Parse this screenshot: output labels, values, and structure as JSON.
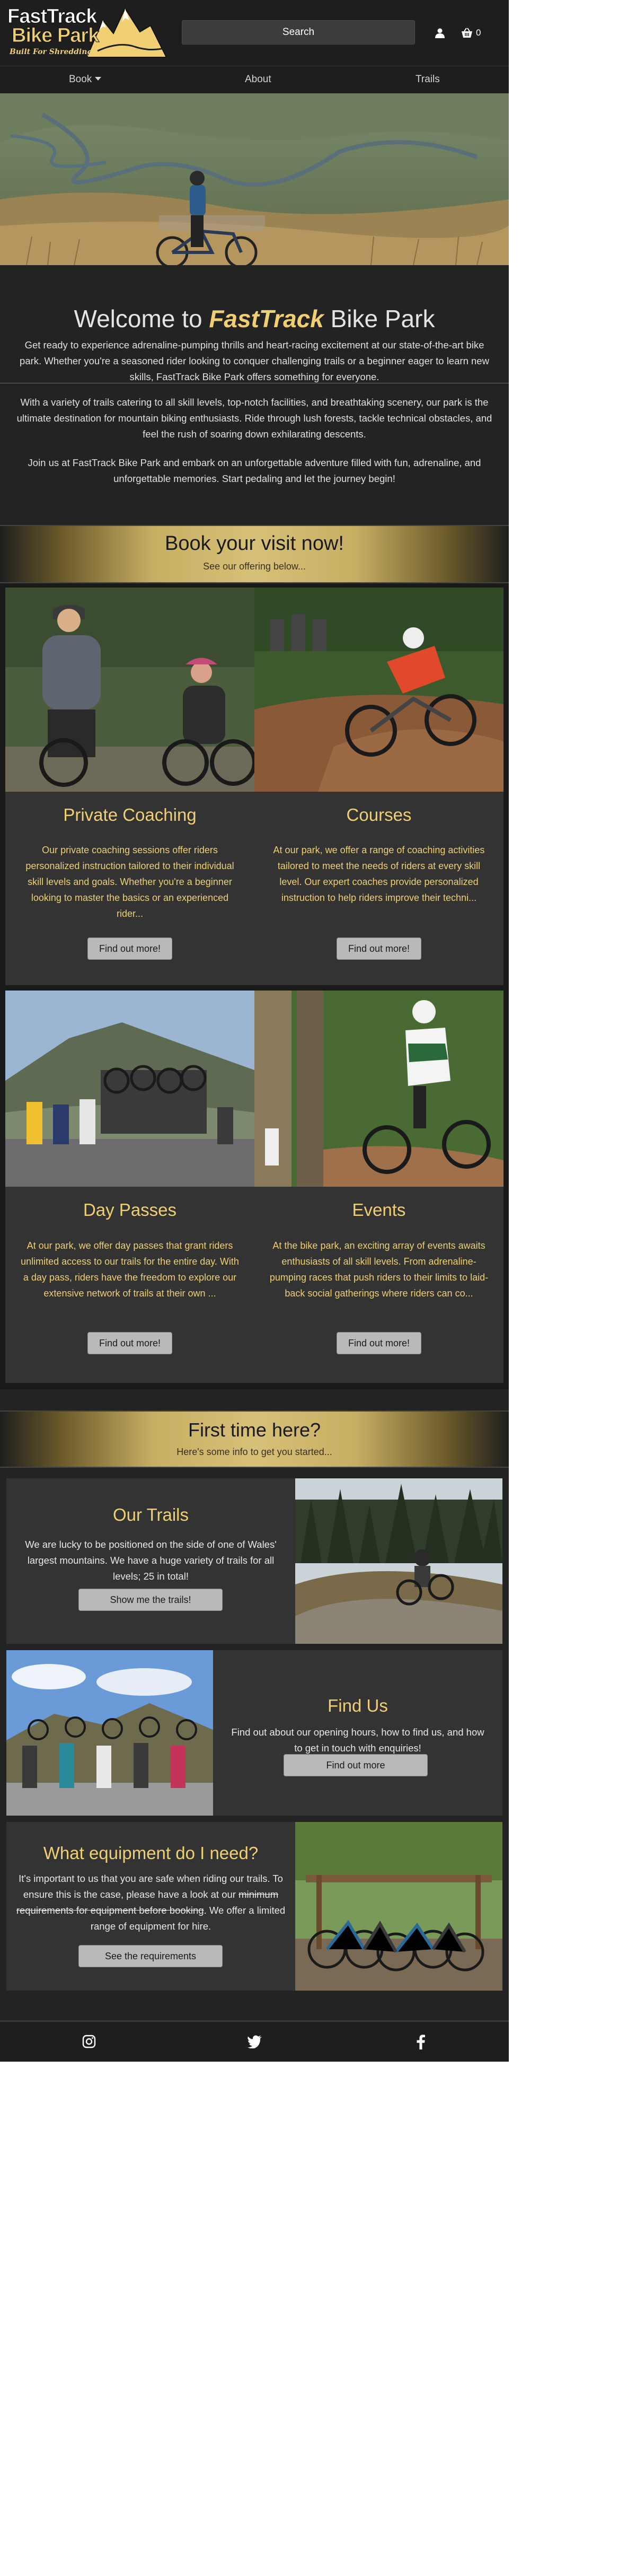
{
  "header": {
    "logo_line1": "FastTrack",
    "logo_line2": "Bike Park",
    "logo_tagline": "Built For Shredding",
    "search_label": "Search",
    "account_icon": "user-icon",
    "cart_icon": "basket-icon",
    "cart_count": "0"
  },
  "nav": {
    "items": [
      {
        "label": "Book",
        "has_dropdown": true
      },
      {
        "label": "About"
      },
      {
        "label": "Trails"
      }
    ]
  },
  "welcome": {
    "title_prefix": "Welcome to ",
    "title_brand": "FastTrack",
    "title_suffix": " Bike Park",
    "paragraphs": [
      "Get ready to experience adrenaline-pumping thrills and heart-racing excitement at our state-of-the-art bike park. Whether you're a seasoned rider looking to conquer challenging trails or a beginner eager to learn new skills, FastTrack Bike Park offers something for everyone.",
      "With a variety of trails catering to all skill levels, top-notch facilities, and breathtaking scenery, our park is the ultimate destination for mountain biking enthusiasts. Ride through lush forests, tackle technical obstacles, and feel the rush of soaring down exhilarating descents.",
      "Join us at FastTrack Bike Park and embark on an unforgettable adventure filled with fun, adrenaline, and unforgettable memories. Start pedaling and let the journey begin!"
    ]
  },
  "booking": {
    "title": "Book your visit now!",
    "subtitle": "See our offering below...",
    "cards": [
      {
        "title": "Private Coaching",
        "text": "Our private coaching sessions offer riders personalized instruction tailored to their individual skill levels and goals. Whether you're a beginner looking to master the basics or an experienced rider...",
        "button": "Find out more!"
      },
      {
        "title": "Courses",
        "text": "At our park, we offer a range of coaching activities tailored to meet the needs of riders at every skill level. Our expert coaches provide personalized instruction to help riders improve their techni...",
        "button": "Find out more!"
      },
      {
        "title": "Day Passes",
        "text": "At our park, we offer day passes that grant riders unlimited access to our trails for the entire day. With a day pass, riders have the freedom to explore our extensive network of trails at their own ...",
        "button": "Find out more!"
      },
      {
        "title": "Events",
        "text": "At the bike park, an exciting array of events awaits enthusiasts of all skill levels. From adrenaline-pumping races that push riders to their limits to laid-back social gatherings where riders can co...",
        "button": "Find out more!"
      }
    ]
  },
  "first_time": {
    "title": "First time here?",
    "subtitle": "Here's some info to get you started...",
    "trails": {
      "title": "Our Trails",
      "text": "We are lucky to be positioned on the side of one of Wales' largest mountains. We have a huge variety of trails for all levels; 25 in total!",
      "button": "Show me the trails!"
    },
    "find_us": {
      "title": "Find Us",
      "text": "Find out about our opening hours, how to find us, and how to get in touch with enquiries!",
      "button": "Find out more"
    },
    "equipment": {
      "title": "What equipment do I need?",
      "text_before": "It's important to us that you are safe when riding our trails. To ensure this is the case, please have a look at our ",
      "text_struck": "minimum requirements for equipment before booking",
      "text_after": ". We offer a limited range of equipment for hire.",
      "button": "See the requirements"
    }
  },
  "footer": {
    "icons": [
      "instagram-icon",
      "twitter-icon",
      "facebook-icon"
    ]
  },
  "colors": {
    "gold": "#f0cf74",
    "dark_bg": "#1e1e1e",
    "card_bg": "#333333",
    "button_bg": "#b9b9b9"
  }
}
